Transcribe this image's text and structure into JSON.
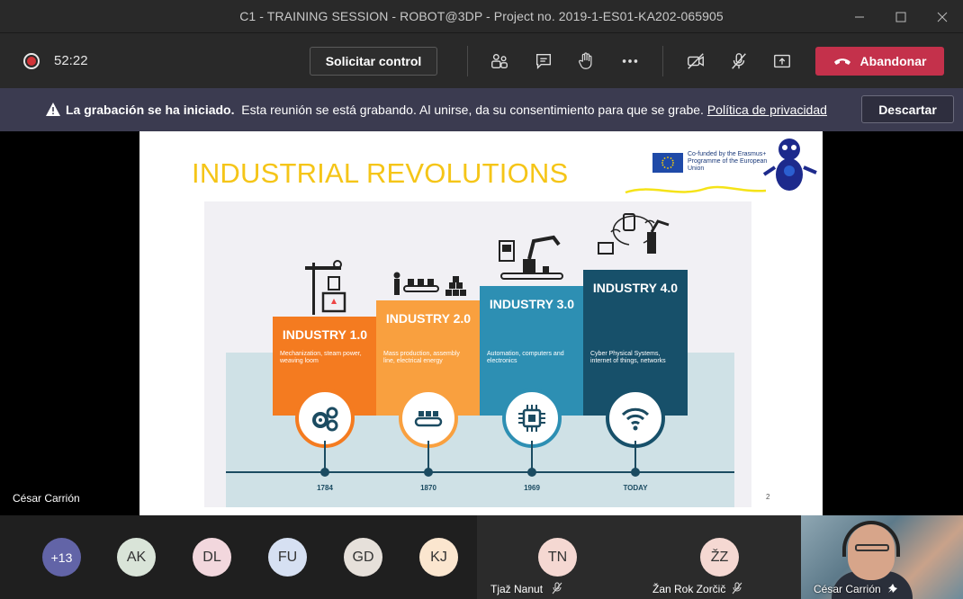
{
  "window": {
    "title": "C1 - TRAINING SESSION - ROBOT@3DP - Project no. 2019-1-ES01-KA202-065905"
  },
  "toolbar": {
    "timer": "52:22",
    "request_control": "Solicitar control",
    "leave": "Abandonar",
    "icons": [
      "participants-icon",
      "chat-icon",
      "raise-hand-icon",
      "more-icon",
      "camera-off-icon",
      "mic-off-icon",
      "share-icon"
    ]
  },
  "banner": {
    "bold": "La grabación se ha iniciado.",
    "message": "Esta reunión se está grabando. Al unirse, da su consentimiento para que se grabe.",
    "link": "Política de privacidad",
    "dismiss": "Descartar"
  },
  "stage": {
    "presenter": "César Carrión"
  },
  "slide": {
    "title": "INDUSTRIAL REVOLUTIONS",
    "eu_text": "Co-funded by the Erasmus+ Programme of the European Union",
    "page": "2",
    "stages": [
      {
        "label": "INDUSTRY 1.0",
        "desc": "Mechanization, steam power, weaving loom",
        "year": "1784",
        "color": "#f47b20"
      },
      {
        "label": "INDUSTRY 2.0",
        "desc": "Mass production, assembly line, electrical energy",
        "year": "1870",
        "color": "#f9a03f"
      },
      {
        "label": "INDUSTRY 3.0",
        "desc": "Automation, computers and electronics",
        "year": "1969",
        "color": "#2d8fb3"
      },
      {
        "label": "INDUSTRY 4.0",
        "desc": "Cyber Physical Systems, internet of things, networks",
        "year": "TODAY",
        "color": "#17506a"
      }
    ]
  },
  "participants": {
    "overflow": "+13",
    "avatars": [
      {
        "initials": "AK",
        "color": "#d9e4d8"
      },
      {
        "initials": "DL",
        "color": "#f2d7dd"
      },
      {
        "initials": "FU",
        "color": "#d6e0f2"
      },
      {
        "initials": "GD",
        "color": "#e6e0da"
      },
      {
        "initials": "KJ",
        "color": "#fbe6cf"
      }
    ],
    "tiles": [
      {
        "initials": "TN",
        "name": "Tjaž Nanut",
        "color": "#f5d8d2"
      },
      {
        "initials": "ŽZ",
        "name": "Žan Rok Zorčič",
        "color": "#f5d8d2"
      }
    ],
    "video_name": "César Carrión"
  }
}
